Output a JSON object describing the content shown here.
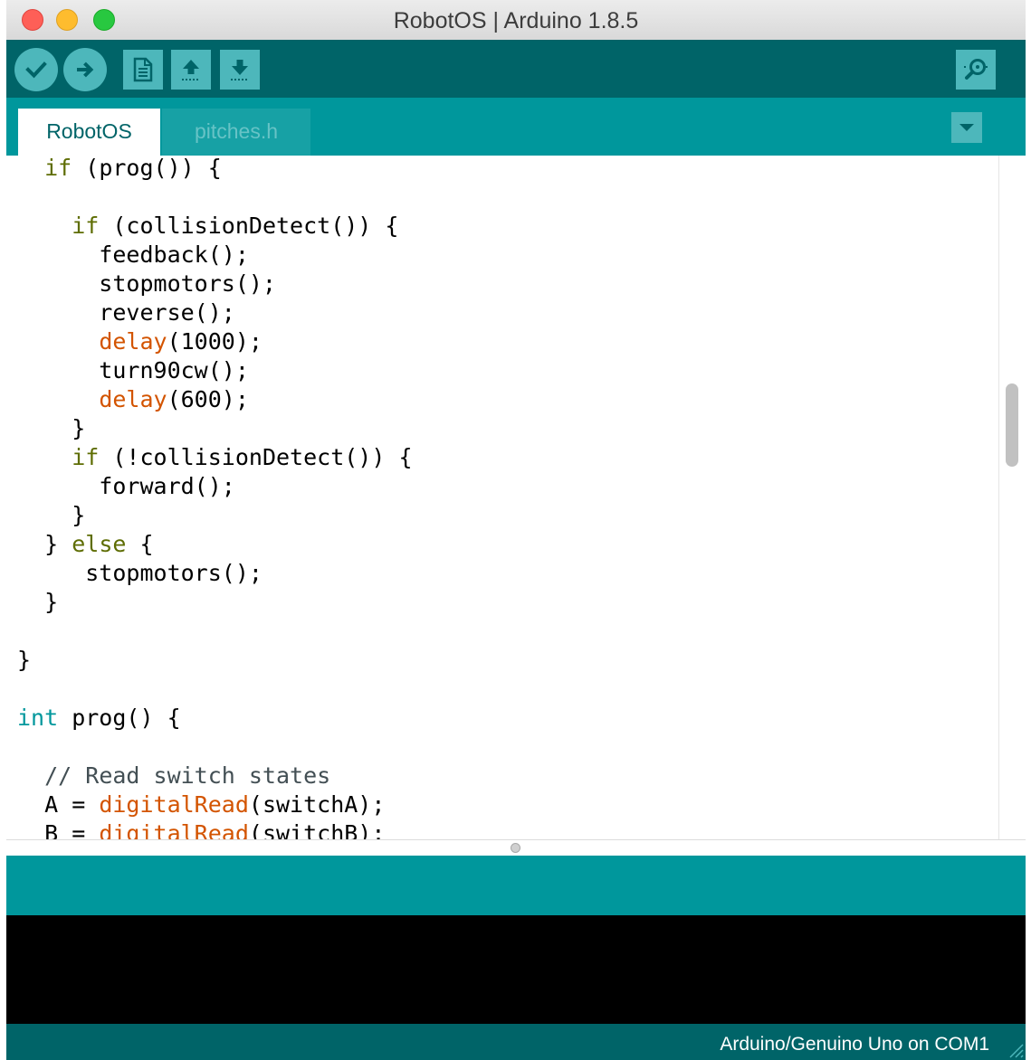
{
  "window": {
    "title": "RobotOS | Arduino 1.8.5"
  },
  "toolbar": {
    "buttons": [
      {
        "name": "verify",
        "icon": "check-icon"
      },
      {
        "name": "upload",
        "icon": "arrow-right-icon"
      },
      {
        "name": "new",
        "icon": "new-file-icon"
      },
      {
        "name": "open",
        "icon": "arrow-up-icon"
      },
      {
        "name": "save",
        "icon": "arrow-down-icon"
      },
      {
        "name": "serial-monitor",
        "icon": "magnifier-icon"
      }
    ]
  },
  "tabs": [
    {
      "label": "RobotOS",
      "active": true
    },
    {
      "label": "pitches.h",
      "active": false
    }
  ],
  "editor": {
    "lines": [
      [
        {
          "t": "  "
        },
        {
          "t": "if",
          "c": "kw"
        },
        {
          "t": " (prog()) {"
        }
      ],
      [
        {
          "t": ""
        }
      ],
      [
        {
          "t": "    "
        },
        {
          "t": "if",
          "c": "kw"
        },
        {
          "t": " (collisionDetect()) {"
        }
      ],
      [
        {
          "t": "      feedback();"
        }
      ],
      [
        {
          "t": "      stopmotors();"
        }
      ],
      [
        {
          "t": "      reverse();"
        }
      ],
      [
        {
          "t": "      "
        },
        {
          "t": "delay",
          "c": "fn"
        },
        {
          "t": "(1000);"
        }
      ],
      [
        {
          "t": "      turn90cw();"
        }
      ],
      [
        {
          "t": "      "
        },
        {
          "t": "delay",
          "c": "fn"
        },
        {
          "t": "(600);"
        }
      ],
      [
        {
          "t": "    }"
        }
      ],
      [
        {
          "t": "    "
        },
        {
          "t": "if",
          "c": "kw"
        },
        {
          "t": " (!collisionDetect()) {"
        }
      ],
      [
        {
          "t": "      forward();"
        }
      ],
      [
        {
          "t": "    }"
        }
      ],
      [
        {
          "t": "  } "
        },
        {
          "t": "else",
          "c": "kw"
        },
        {
          "t": " {"
        }
      ],
      [
        {
          "t": "     stopmotors();"
        }
      ],
      [
        {
          "t": "  }"
        }
      ],
      [
        {
          "t": ""
        }
      ],
      [
        {
          "t": "}"
        }
      ],
      [
        {
          "t": ""
        }
      ],
      [
        {
          "t": "int",
          "c": "ty"
        },
        {
          "t": " prog() {"
        }
      ],
      [
        {
          "t": ""
        }
      ],
      [
        {
          "t": "  "
        },
        {
          "t": "// Read switch states",
          "c": "cm"
        }
      ],
      [
        {
          "t": "  A = "
        },
        {
          "t": "digitalRead",
          "c": "fn"
        },
        {
          "t": "(switchA);"
        }
      ],
      [
        {
          "t": "  B = "
        },
        {
          "t": "digitalRead",
          "c": "fn"
        },
        {
          "t": "(switchB);"
        }
      ]
    ]
  },
  "message": {
    "text": ""
  },
  "console": {
    "text": ""
  },
  "status": {
    "board": "Arduino/Genuino Uno on COM1"
  },
  "colors": {
    "toolbar": "#006468",
    "tabbar": "#00979c",
    "button": "#4db7bb",
    "keyword": "#5e6d03",
    "function": "#d35400",
    "type": "#00979c",
    "comment": "#434f54"
  }
}
